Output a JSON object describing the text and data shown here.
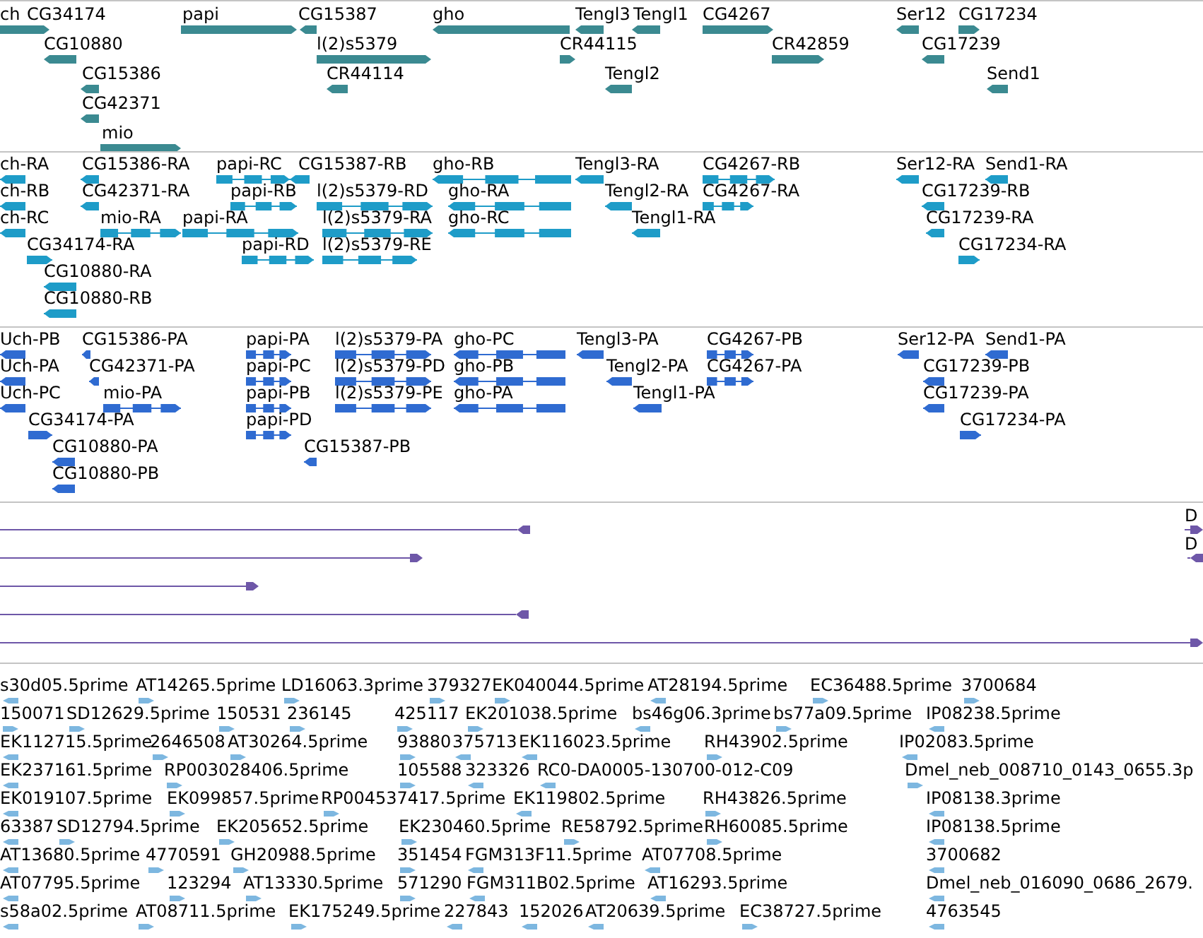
{
  "tracks": [
    {
      "kind": "gene",
      "features": [
        {
          "label": "ch"
        },
        {
          "label": "CG34174",
          "forward": true
        },
        {
          "label": "papi",
          "forward": true
        },
        {
          "label": "CG15387",
          "forward": false
        },
        {
          "label": "gho",
          "forward": false
        },
        {
          "label": "Tengl3",
          "forward": false
        },
        {
          "label": "Tengl1",
          "forward": false
        },
        {
          "label": "CG4267",
          "forward": true
        },
        {
          "label": "Ser12",
          "forward": false
        },
        {
          "label": "CG17234",
          "forward": true
        },
        {
          "label": "CG10880",
          "forward": false
        },
        {
          "label": "l(2)s5379",
          "forward": true
        },
        {
          "label": "CR44115",
          "forward": true
        },
        {
          "label": "CR42859",
          "forward": true
        },
        {
          "label": "CG17239",
          "forward": false
        },
        {
          "label": "CG15386",
          "forward": false
        },
        {
          "label": "CR44114",
          "forward": false
        },
        {
          "label": "Tengl2",
          "forward": false
        },
        {
          "label": "Send1",
          "forward": false
        },
        {
          "label": "CG42371",
          "forward": false
        },
        {
          "label": "mio",
          "forward": true
        }
      ]
    },
    {
      "kind": "transcript",
      "features": [
        {
          "label": "ch-RA",
          "forward": false
        },
        {
          "label": "CG15386-RA",
          "forward": false
        },
        {
          "label": "papi-RC",
          "forward": true
        },
        {
          "label": "CG15387-RB",
          "forward": false
        },
        {
          "label": "gho-RB",
          "forward": false
        },
        {
          "label": "Tengl3-RA",
          "forward": false
        },
        {
          "label": "CG4267-RB",
          "forward": true
        },
        {
          "label": "Ser12-RA",
          "forward": false
        },
        {
          "label": "Send1-RA",
          "forward": false
        },
        {
          "label": "ch-RB",
          "forward": false
        },
        {
          "label": "CG42371-RA",
          "forward": false
        },
        {
          "label": "papi-RB",
          "forward": true
        },
        {
          "label": "l(2)s5379-RD",
          "forward": true
        },
        {
          "label": "gho-RA",
          "forward": false
        },
        {
          "label": "Tengl2-RA",
          "forward": false
        },
        {
          "label": "CG4267-RA",
          "forward": true
        },
        {
          "label": "CG17239-RB",
          "forward": false
        },
        {
          "label": "ch-RC",
          "forward": false
        },
        {
          "label": "mio-RA",
          "forward": true
        },
        {
          "label": "papi-RA",
          "forward": true
        },
        {
          "label": "l(2)s5379-RA",
          "forward": true
        },
        {
          "label": "gho-RC",
          "forward": false
        },
        {
          "label": "Tengl1-RA",
          "forward": false
        },
        {
          "label": "CG17239-RA",
          "forward": false
        },
        {
          "label": "CG34174-RA",
          "forward": true
        },
        {
          "label": "papi-RD",
          "forward": true
        },
        {
          "label": "l(2)s5379-RE",
          "forward": true
        },
        {
          "label": "CG17234-RA",
          "forward": true
        },
        {
          "label": "CG10880-RA",
          "forward": false
        },
        {
          "label": "CG10880-RB",
          "forward": false
        }
      ]
    },
    {
      "kind": "protein",
      "features": [
        {
          "label": "Uch-PB",
          "forward": false
        },
        {
          "label": "CG15386-PA",
          "forward": false
        },
        {
          "label": "papi-PA",
          "forward": true
        },
        {
          "label": "l(2)s5379-PA",
          "forward": true
        },
        {
          "label": "gho-PC",
          "forward": false
        },
        {
          "label": "Tengl3-PA",
          "forward": false
        },
        {
          "label": "CG4267-PB",
          "forward": true
        },
        {
          "label": "Ser12-PA",
          "forward": false
        },
        {
          "label": "Send1-PA",
          "forward": false
        },
        {
          "label": "Uch-PA",
          "forward": false
        },
        {
          "label": "CG42371-PA",
          "forward": false
        },
        {
          "label": "papi-PC",
          "forward": true
        },
        {
          "label": "l(2)s5379-PD",
          "forward": true
        },
        {
          "label": "gho-PB",
          "forward": false
        },
        {
          "label": "Tengl2-PA",
          "forward": false
        },
        {
          "label": "CG4267-PA",
          "forward": true
        },
        {
          "label": "CG17239-PB",
          "forward": false
        },
        {
          "label": "Uch-PC",
          "forward": false
        },
        {
          "label": "mio-PA",
          "forward": true
        },
        {
          "label": "papi-PB",
          "forward": true
        },
        {
          "label": "l(2)s5379-PE",
          "forward": true
        },
        {
          "label": "gho-PA",
          "forward": false
        },
        {
          "label": "Tengl1-PA",
          "forward": false
        },
        {
          "label": "CG17239-PA",
          "forward": false
        },
        {
          "label": "CG34174-PA",
          "forward": true
        },
        {
          "label": "papi-PD",
          "forward": true
        },
        {
          "label": "CG17234-PA",
          "forward": true
        },
        {
          "label": "CG10880-PA",
          "forward": false
        },
        {
          "label": "CG15387-PB",
          "forward": false
        },
        {
          "label": "CG10880-PB",
          "forward": false
        }
      ]
    },
    {
      "kind": "alignment",
      "features": [
        {
          "forward": false
        },
        {
          "forward": true
        },
        {
          "forward": true
        },
        {
          "forward": false
        },
        {
          "forward": true
        },
        {
          "label": "D",
          "forward": true
        },
        {
          "label": "D",
          "forward": false
        }
      ]
    },
    {
      "kind": "est",
      "features": [
        {
          "label": "s30d05.5prime",
          "forward": false
        },
        {
          "label": "AT14265.5prime",
          "forward": true
        },
        {
          "label": "LD16063.3prime",
          "forward": true
        },
        {
          "label": "379327",
          "forward": true
        },
        {
          "label": "EK040044.5prime",
          "forward": true
        },
        {
          "label": "AT28194.5prime",
          "forward": false
        },
        {
          "label": "EC36488.5prime",
          "forward": true
        },
        {
          "label": "3700684",
          "forward": true
        },
        {
          "label": "150071",
          "forward": true
        },
        {
          "label": "SD12629.5prime",
          "forward": true
        },
        {
          "label": "150531",
          "forward": true
        },
        {
          "label": "236145",
          "forward": true
        },
        {
          "label": "425117",
          "forward": true
        },
        {
          "label": "EK201038.5prime",
          "forward": true
        },
        {
          "label": "bs46g06.3prime",
          "forward": false
        },
        {
          "label": "bs77a09.5prime",
          "forward": true
        },
        {
          "label": "IP08238.5prime",
          "forward": false
        },
        {
          "label": "EK112715.5prime",
          "forward": false
        },
        {
          "label": "2646508",
          "forward": true
        },
        {
          "label": "AT30264.5prime",
          "forward": true
        },
        {
          "label": "93880",
          "forward": true
        },
        {
          "label": "375713",
          "forward": false
        },
        {
          "label": "EK116023.5prime",
          "forward": false
        },
        {
          "label": "RH43902.5prime",
          "forward": true
        },
        {
          "label": "IP02083.5prime",
          "forward": false
        },
        {
          "label": "EK237161.5prime",
          "forward": false
        },
        {
          "label": "RP003028406.5prime",
          "forward": true
        },
        {
          "label": "105588",
          "forward": true
        },
        {
          "label": "323326",
          "forward": false
        },
        {
          "label": "RC0-DA0005-130700-012-C09",
          "forward": false
        },
        {
          "label": "Dmel_neb_008710_0143_0655.3p",
          "forward": true
        },
        {
          "label": "EK019107.5prime",
          "forward": false
        },
        {
          "label": "EK099857.5prime",
          "forward": true
        },
        {
          "label": "RP004537417.5prime",
          "forward": true
        },
        {
          "label": "EK119802.5prime",
          "forward": false
        },
        {
          "label": "RH43826.5prime",
          "forward": true
        },
        {
          "label": "IP08138.3prime",
          "forward": false
        },
        {
          "label": "63387",
          "forward": false
        },
        {
          "label": "SD12794.5prime",
          "forward": true
        },
        {
          "label": "EK205652.5prime",
          "forward": true
        },
        {
          "label": "EK230460.5prime",
          "forward": true
        },
        {
          "label": "RE58792.5prime",
          "forward": true
        },
        {
          "label": "RH60085.5prime",
          "forward": true
        },
        {
          "label": "IP08138.5prime",
          "forward": false
        },
        {
          "label": "AT13680.5prime",
          "forward": false
        },
        {
          "label": "4770591",
          "forward": true
        },
        {
          "label": "GH20988.5prime",
          "forward": true
        },
        {
          "label": "351454",
          "forward": true
        },
        {
          "label": "FGM313F11.5prime",
          "forward": false
        },
        {
          "label": "AT07708.5prime",
          "forward": false
        },
        {
          "label": "3700682",
          "forward": false
        },
        {
          "label": "AT07795.5prime",
          "forward": false
        },
        {
          "label": "123294",
          "forward": true
        },
        {
          "label": "AT13330.5prime",
          "forward": true
        },
        {
          "label": "571290",
          "forward": true
        },
        {
          "label": "FGM311B02.5prime",
          "forward": false
        },
        {
          "label": "AT16293.5prime",
          "forward": false
        },
        {
          "label": "Dmel_neb_016090_0686_2679.",
          "forward": false
        },
        {
          "label": "s58a02.5prime",
          "forward": false
        },
        {
          "label": "AT08711.5prime",
          "forward": true
        },
        {
          "label": "EK175249.5prime",
          "forward": true
        },
        {
          "label": "227843",
          "forward": false
        },
        {
          "label": "152026",
          "forward": false
        },
        {
          "label": "AT20639.5prime",
          "forward": false
        },
        {
          "label": "EC38727.5prime",
          "forward": true
        },
        {
          "label": "4763545",
          "forward": false
        }
      ]
    }
  ]
}
